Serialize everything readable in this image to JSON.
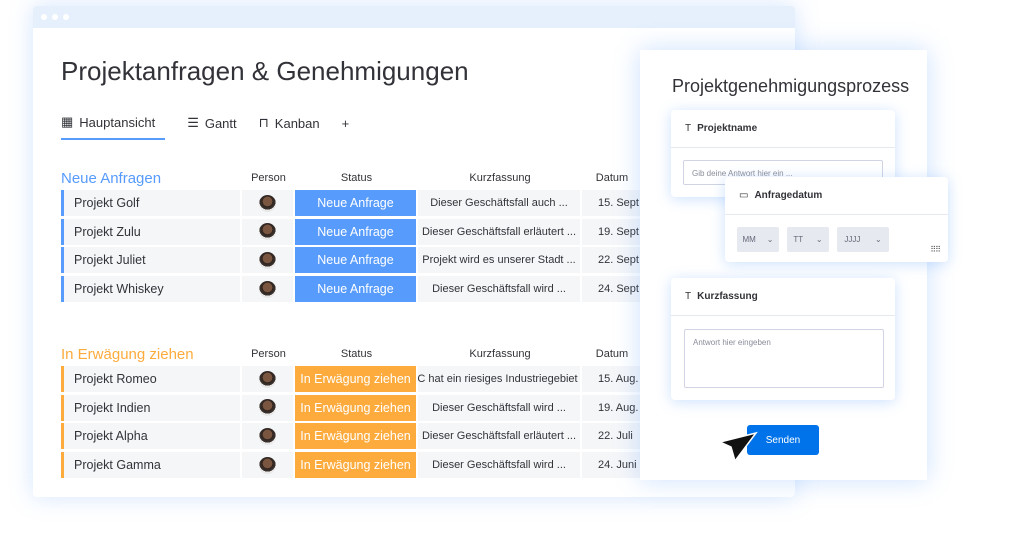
{
  "board": {
    "title": "Projektanfragen & Genehmigungen",
    "tabs": [
      {
        "label": "Hauptansicht",
        "icon": "table-icon"
      },
      {
        "label": "Gantt",
        "icon": "gantt-icon"
      },
      {
        "label": "Kanban",
        "icon": "kanban-icon"
      }
    ],
    "add_tab": "+",
    "columns": {
      "person": "Person",
      "status": "Status",
      "kurz": "Kurzfassung",
      "datum": "Datum"
    },
    "groups": [
      {
        "title": "Neue Anfragen",
        "color": "#579bfc",
        "rows": [
          {
            "name": "Projekt Golf",
            "status": "Neue Anfrage",
            "kurz": "Dieser Geschäftsfall auch ...",
            "datum": "15. Sept."
          },
          {
            "name": "Projekt Zulu",
            "status": "Neue Anfrage",
            "kurz": "Dieser Geschäftsfall erläutert ...",
            "datum": "19. Sept."
          },
          {
            "name": "Projekt Juliet",
            "status": "Neue Anfrage",
            "kurz": "Projekt wird es unserer Stadt ...",
            "datum": "22. Sept."
          },
          {
            "name": "Projekt Whiskey",
            "status": "Neue Anfrage",
            "kurz": "Dieser Geschäftsfall wird ...",
            "datum": "24. Sept."
          }
        ]
      },
      {
        "title": "In Erwägung ziehen",
        "color": "#fdab3d",
        "rows": [
          {
            "name": "Projekt Romeo",
            "status": "In Erwägung ziehen",
            "kurz": "LIC hat ein riesiges Industriegebiet ...",
            "datum": "15. Aug."
          },
          {
            "name": "Projekt Indien",
            "status": "In Erwägung ziehen",
            "kurz": "Dieser Geschäftsfall wird ...",
            "datum": "19. Aug."
          },
          {
            "name": "Projekt Alpha",
            "status": "In Erwägung ziehen",
            "kurz": "Dieser Geschäftsfall erläutert ...",
            "datum": "22. Juli"
          },
          {
            "name": "Projekt Gamma",
            "status": "In Erwägung ziehen",
            "kurz": "Dieser Geschäftsfall wird ...",
            "datum": "24. Juni"
          }
        ]
      }
    ]
  },
  "form": {
    "title": "Projektgenehmigungsprozess",
    "projektname": {
      "label": "Projektname",
      "placeholder": "Gib deine Antwort hier ein ..."
    },
    "datum": {
      "label": "Anfragedatum",
      "mm": "MM",
      "tt": "TT",
      "jjjj": "JJJJ"
    },
    "kurz": {
      "label": "Kurzfassung",
      "placeholder": "Antwort hier eingeben"
    },
    "submit": "Senden"
  }
}
